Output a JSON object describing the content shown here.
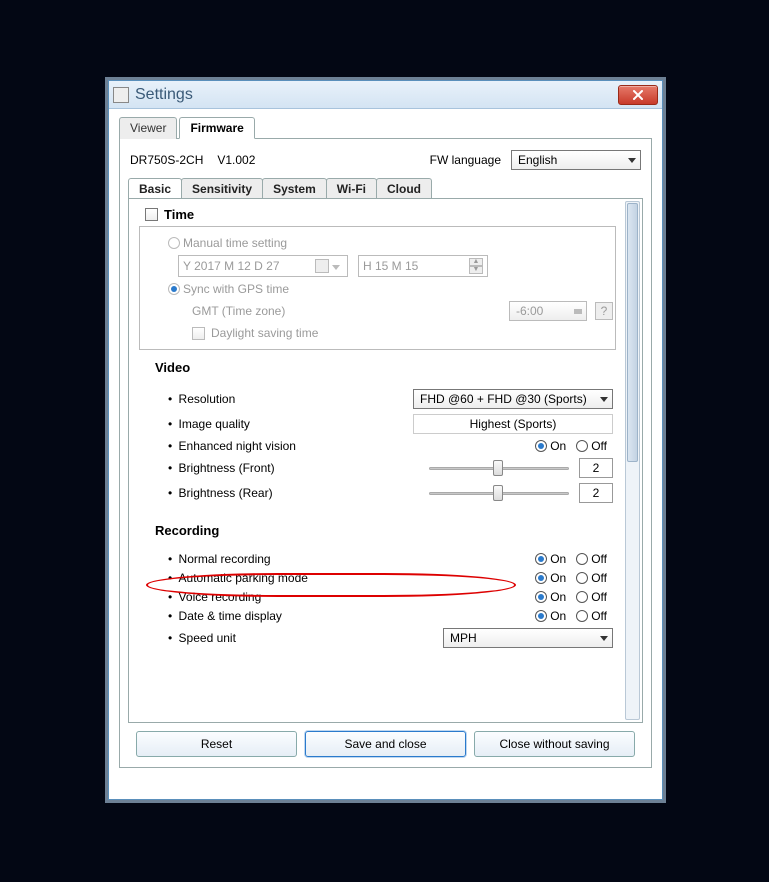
{
  "window": {
    "title": "Settings"
  },
  "outer_tabs": {
    "viewer": "Viewer",
    "firmware": "Firmware"
  },
  "fw": {
    "model": "DR750S-2CH",
    "version": "V1.002",
    "lang_label": "FW language",
    "lang_value": "English"
  },
  "inner_tabs": {
    "basic": "Basic",
    "sensitivity": "Sensitivity",
    "system": "System",
    "wifi": "Wi-Fi",
    "cloud": "Cloud"
  },
  "time": {
    "header": "Time",
    "manual": "Manual time setting",
    "date": "Y 2017 M 12 D 27",
    "clock": "H 15 M 15",
    "sync": "Sync with GPS time",
    "gmt_label": "GMT (Time zone)",
    "gmt_value": "-6:00",
    "help": "?",
    "dst": "Daylight saving time"
  },
  "video": {
    "header": "Video",
    "resolution_label": "Resolution",
    "resolution_value": "FHD @60 + FHD @30 (Sports)",
    "iq_label": "Image quality",
    "iq_value": "Highest (Sports)",
    "env_label": "Enhanced night vision",
    "bf_label": "Brightness (Front)",
    "bf_value": "2",
    "br_label": "Brightness (Rear)",
    "br_value": "2"
  },
  "rec": {
    "header": "Recording",
    "normal": "Normal recording",
    "parking": "Automatic parking mode",
    "voice": "Voice recording",
    "datetime": "Date & time display",
    "speed_label": "Speed unit",
    "speed_value": "MPH"
  },
  "onoff": {
    "on": "On",
    "off": "Off"
  },
  "footer": {
    "reset": "Reset",
    "save": "Save and close",
    "close": "Close without saving"
  }
}
